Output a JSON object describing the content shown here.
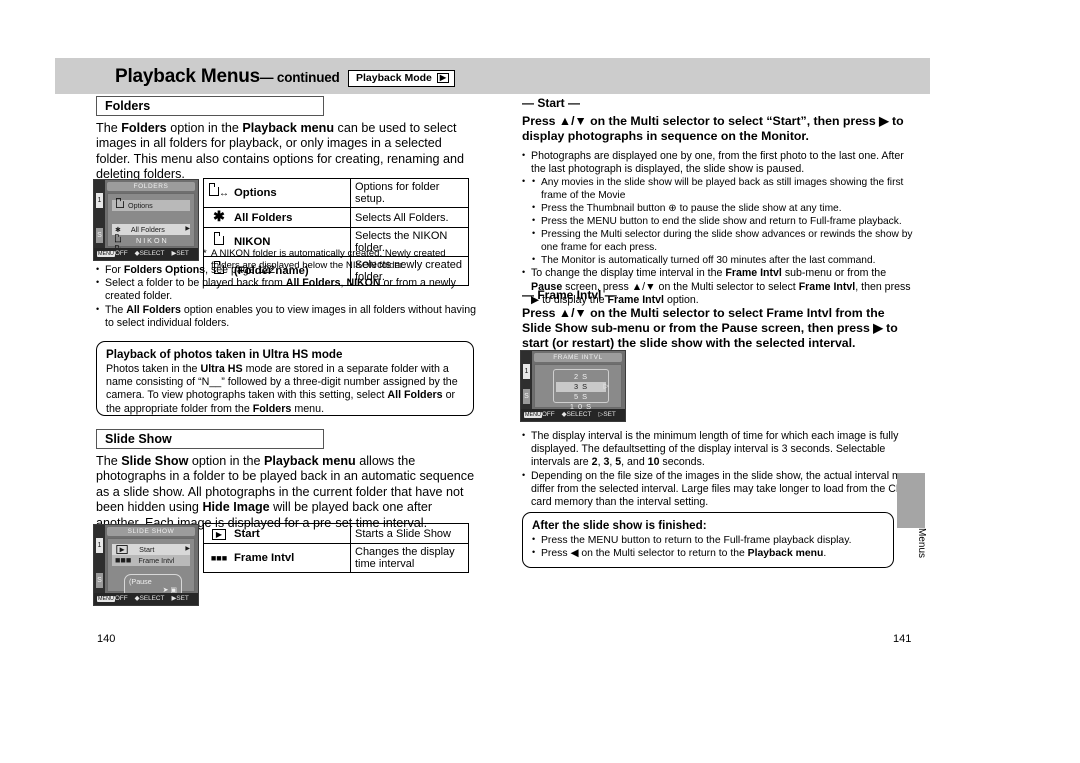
{
  "header": {
    "title": "Playback Menus",
    "continued": "— continued",
    "mode_badge": "Playback Mode",
    "mode_badge_icon": "▶"
  },
  "left_column": {
    "folders": {
      "section_title": "Folders",
      "intro": "The Folders option in the Playback menu can be used to select images in all folders for playback, or only images in a selected folder. This menu also contains options for creating, renaming and deleting folders.",
      "lcd": {
        "title": "FOLDERS",
        "tab_top": "1",
        "tab_bottom": "S",
        "option_row": "Options",
        "item_all_folders": "All Folders",
        "item_nikon": "N I K O N",
        "bottom_menu": "MENU",
        "bottom_off": "OFF",
        "bottom_select": "SELECT",
        "bottom_set": "SET"
      },
      "table": {
        "rows": [
          {
            "icon": "folder-arrows-icon",
            "name": "Options",
            "desc": "Options for folder setup."
          },
          {
            "icon": "asterisk-icon",
            "name": "All Folders",
            "desc": "Selects All Folders."
          },
          {
            "icon": "folder-icon",
            "name": "NIKON",
            "desc": "Selects the NIKON folder."
          },
          {
            "icon": "folder-icon",
            "name": "(Folder name)",
            "desc": "Selects newly created folder."
          }
        ]
      },
      "footnote": "A NIKON folder is automatically created. Newly created folders are displayed below the NIKON folder.",
      "bullets": [
        "For Folders Options, see page 122.",
        "Select a folder to be played back from All Folders, NIKON or from a newly created folder.",
        "The All Folders option enables you to view images in all folders without having to select individual folders."
      ]
    },
    "ultra_hs": {
      "heading": "Playback of photos taken in Ultra HS mode",
      "body": "Photos taken in the Ultra HS mode are stored in a separate folder with a name consisting of “N__” followed by a three-digit number assigned by the camera. To view photographs taken with this setting, select All Folders or the appropriate folder from the Folders menu."
    },
    "slide_show": {
      "section_title": "Slide Show",
      "intro": "The Slide Show option in the Playback menu allows the photographs in a folder to be played back in an automatic sequence as a slide show. All photographs in the current folder that have not been hidden using Hide Image will be played back one after another. Each image is displayed for a pre-set time interval.",
      "lcd": {
        "title": "SLIDE SHOW",
        "tab_top": "1",
        "tab_bottom": "S",
        "item_start": "Start",
        "item_frame_intvl": "Frame Intvl",
        "pause_label": "(Pause",
        "bottom_menu": "MENU",
        "bottom_off": "OFF",
        "bottom_select": "SELECT",
        "bottom_set": "SET"
      },
      "table": {
        "rows": [
          {
            "icon": "play-icon",
            "name": "Start",
            "desc": "Starts a Slide Show"
          },
          {
            "icon": "frames-icon",
            "name": "Frame Intvl",
            "desc": "Changes the display time interval"
          }
        ]
      }
    }
  },
  "right_column": {
    "start": {
      "dash_heading": "— Start —",
      "lead": "Press ▲/▼ on the Multi selector to select “Start”, then press ▶ to display photographs in sequence on the Monitor.",
      "bullet_main_1": "Photographs are displayed one by one, from the first photo to the last one. After the last photograph is displayed, the slide show is paused.",
      "sub_bullets": [
        "Any movies in the slide show will be played back as still images showing the first frame of the Movie",
        "Press the Thumbnail button ⊕ to pause the slide show at any time.",
        "Press the MENU button to end the slide show and return to Full-frame playback.",
        "Pressing the Multi selector during the slide show advances or rewinds the show by one frame for each press.",
        "The Monitor is automatically turned off 30 minutes after the last command."
      ],
      "bullet_main_2": "To change the display time interval in the Frame Intvl sub-menu or from the Pause screen, press ▲/▼ on the Multi selector to select Frame Intvl, then press ▶ to display the Frame Intvl option."
    },
    "frame_intvl": {
      "dash_heading": "— Frame Intvl —",
      "lead": "Press ▲/▼ on the Multi selector to select Frame Intvl from the Slide Show sub-menu or from the Pause screen, then press ▶ to start (or restart) the slide show with the selected interval.",
      "lcd": {
        "title": "FRAME INTVL",
        "tab_top": "1",
        "tab_bottom": "S",
        "options": [
          "2  S",
          "3  S",
          "5  S",
          "1 0  S"
        ],
        "selected_index": 1,
        "bottom_menu": "MENU",
        "bottom_off": "OFF",
        "bottom_select": "SELECT",
        "bottom_set": "SET"
      },
      "bullets": [
        "The display interval is the minimum length of time for which each image is fully displayed. The defaultsetting of the display interval is 3 seconds. Selectable intervals are 2, 3, 5, and 10 seconds.",
        "Depending on the file size of the images in the slide show, the actual interval may differ from the selected interval. Large files may take longer to load from the CF card memory than the interval setting."
      ]
    },
    "finished_box": {
      "heading": "After the slide show is finished:",
      "bullets": [
        "Press the MENU button to return to the Full-frame playback display.",
        "Press ◀ on the Multi selector to return to the Playback menu."
      ]
    }
  },
  "side_tab": {
    "label": "Menus"
  },
  "footer": {
    "page_left": "140",
    "page_right": "141"
  },
  "colors": {
    "band": "#cccccc",
    "side_tab": "#a5a5a5",
    "lcd_bg": "#6f6f6f"
  }
}
